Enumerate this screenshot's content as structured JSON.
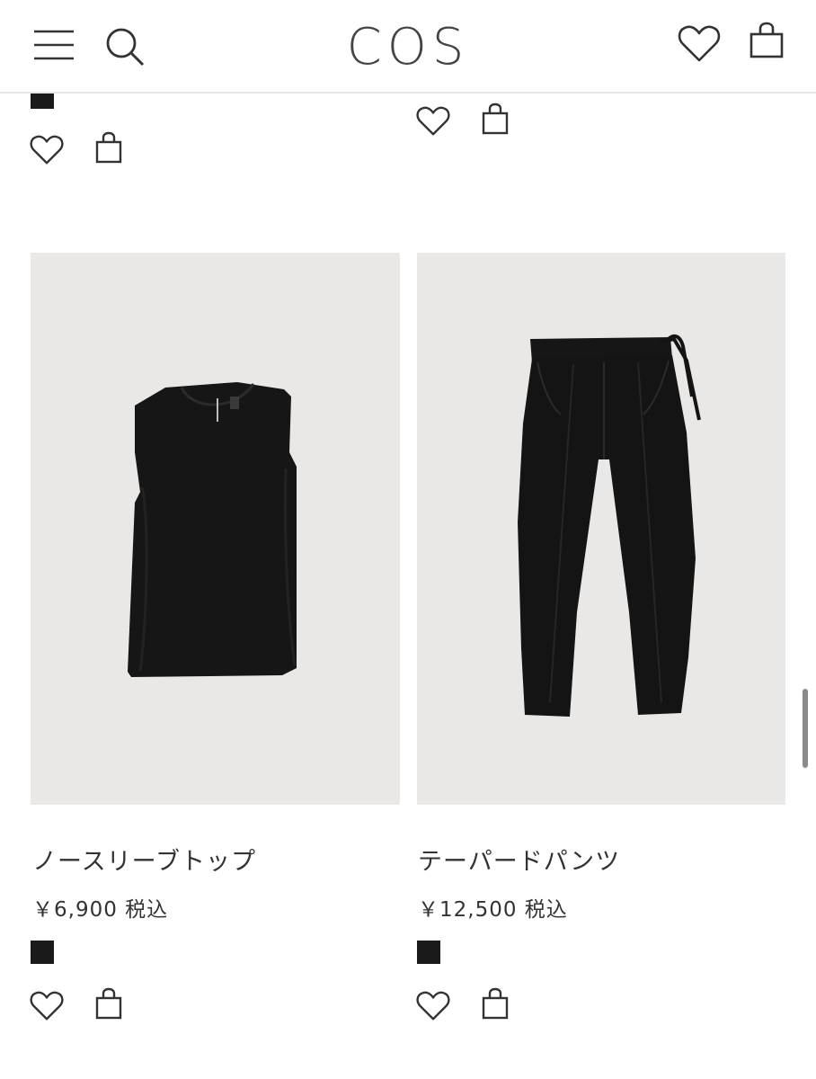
{
  "header": {
    "logo_text": "COS",
    "icons": [
      "menu-icon",
      "search-icon",
      "heart-icon",
      "bag-icon"
    ]
  },
  "products": [
    {
      "name": "ノースリーブトップ",
      "price": "￥6,900 税込",
      "swatch_color": "#1a1a1a",
      "image": "black sleeveless top"
    },
    {
      "name": "テーパードパンツ",
      "price": "￥12,500 税込",
      "swatch_color": "#1a1a1a",
      "image": "black tapered trousers"
    }
  ],
  "colors": {
    "text": "#333333",
    "image_bg": "#e9e8e6",
    "swatch": "#1a1a1a",
    "divider": "#e6e6e6"
  }
}
